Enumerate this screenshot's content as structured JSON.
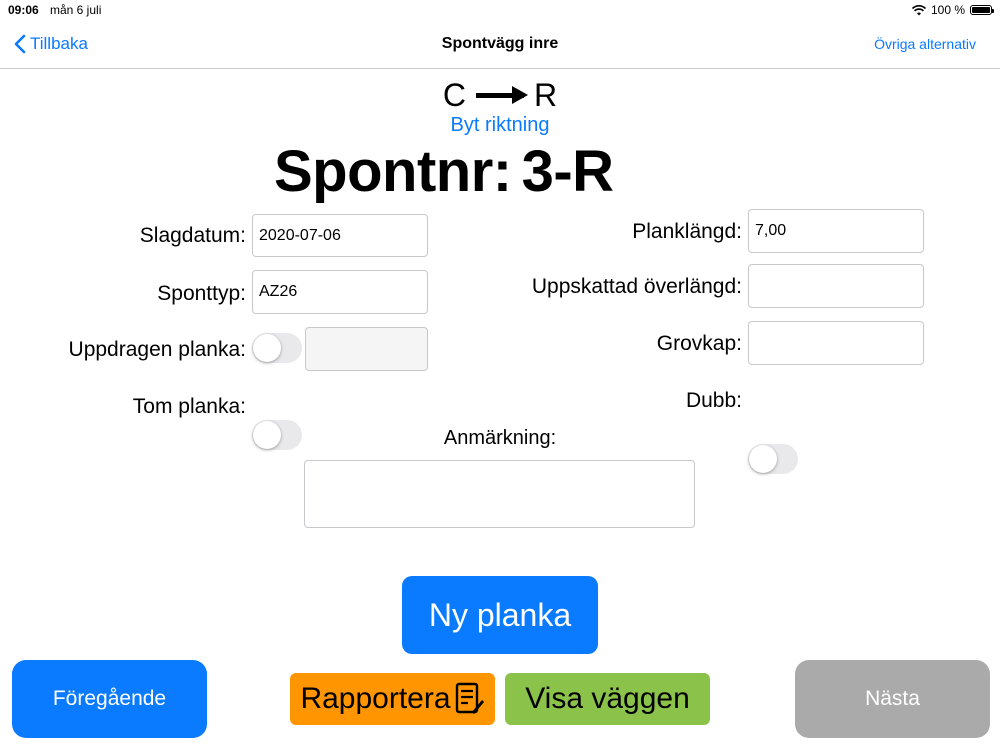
{
  "status_bar": {
    "time": "09:06",
    "date": "mån 6 juli",
    "battery": "100 %"
  },
  "nav": {
    "back_label": "Tillbaka",
    "title": "Spontvägg inre",
    "more_label": "Övriga alternativ"
  },
  "direction": {
    "from": "C",
    "to": "R",
    "swap_label": "Byt riktning"
  },
  "heading": {
    "label": "Spontnr:",
    "value": "3-R"
  },
  "form": {
    "slagdatum": {
      "label": "Slagdatum:",
      "value": "2020-07-06"
    },
    "sponttyp": {
      "label": "Sponttyp:",
      "value": "AZ26"
    },
    "uppdragen": {
      "label": "Uppdragen planka:",
      "value": "",
      "toggled": false
    },
    "tom": {
      "label": "Tom planka:",
      "toggled": false
    },
    "planklangd": {
      "label": "Planklängd:",
      "value": "7,00"
    },
    "overlangd": {
      "label": "Uppskattad överlängd:",
      "value": ""
    },
    "grovkap": {
      "label": "Grovkap:",
      "value": ""
    },
    "dubb": {
      "label": "Dubb:",
      "toggled": false
    },
    "anmarkning": {
      "label": "Anmärkning:",
      "value": ""
    }
  },
  "buttons": {
    "new_plank": "Ny planka",
    "previous": "Föregående",
    "report": "Rapportera",
    "show_wall": "Visa väggen",
    "next": "Nästa"
  },
  "colors": {
    "accent": "#0a7aff",
    "report": "#ff9500",
    "show_wall": "#8bc34a",
    "disabled": "#aaaaaa"
  }
}
